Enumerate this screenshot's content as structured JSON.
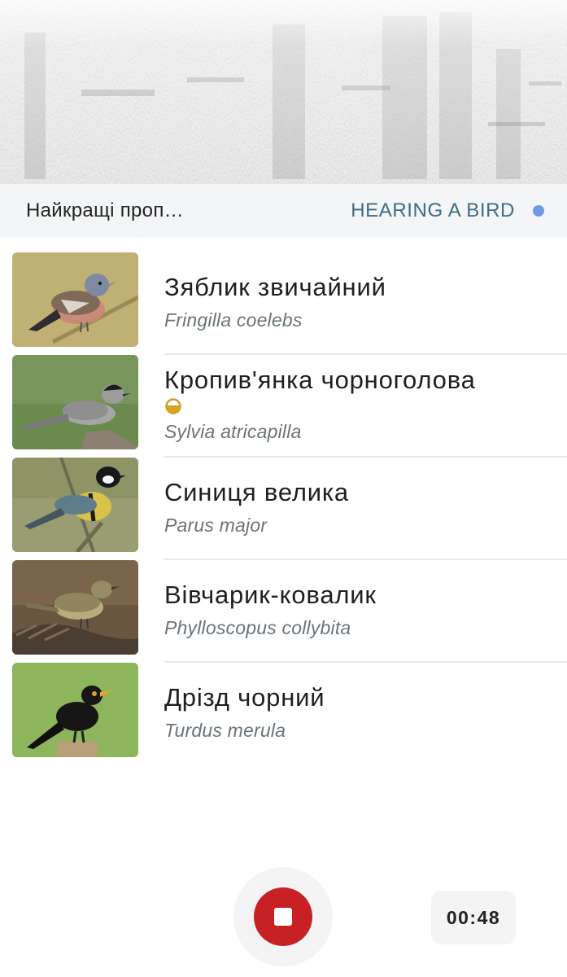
{
  "spectrogram": {
    "icon": "spectrogram-image"
  },
  "status": {
    "title": "Найкращі проп…",
    "indicator_text": "HEARING A BIRD",
    "indicator_color": "#6f9be6"
  },
  "species": [
    {
      "common_name": "Зяблик звичайний",
      "latin_name": "Fringilla coelebs",
      "photo": "chaffinch-photo"
    },
    {
      "common_name": "Кропив'янка чорноголова",
      "latin_name": "Sylvia atricapilla",
      "photo": "blackcap-photo",
      "badge": "half-circle-badge-icon"
    },
    {
      "common_name": "Синиця велика",
      "latin_name": "Parus major",
      "photo": "great-tit-photo"
    },
    {
      "common_name": "Вівчарик-ковалик",
      "latin_name": "Phylloscopus collybita",
      "photo": "chiffchaff-photo"
    },
    {
      "common_name": "Дрізд чорний",
      "latin_name": "Turdus merula",
      "photo": "blackbird-photo"
    }
  ],
  "controls": {
    "stop_icon": "stop-icon",
    "stop_color": "#c72025",
    "timer": "00:48"
  }
}
